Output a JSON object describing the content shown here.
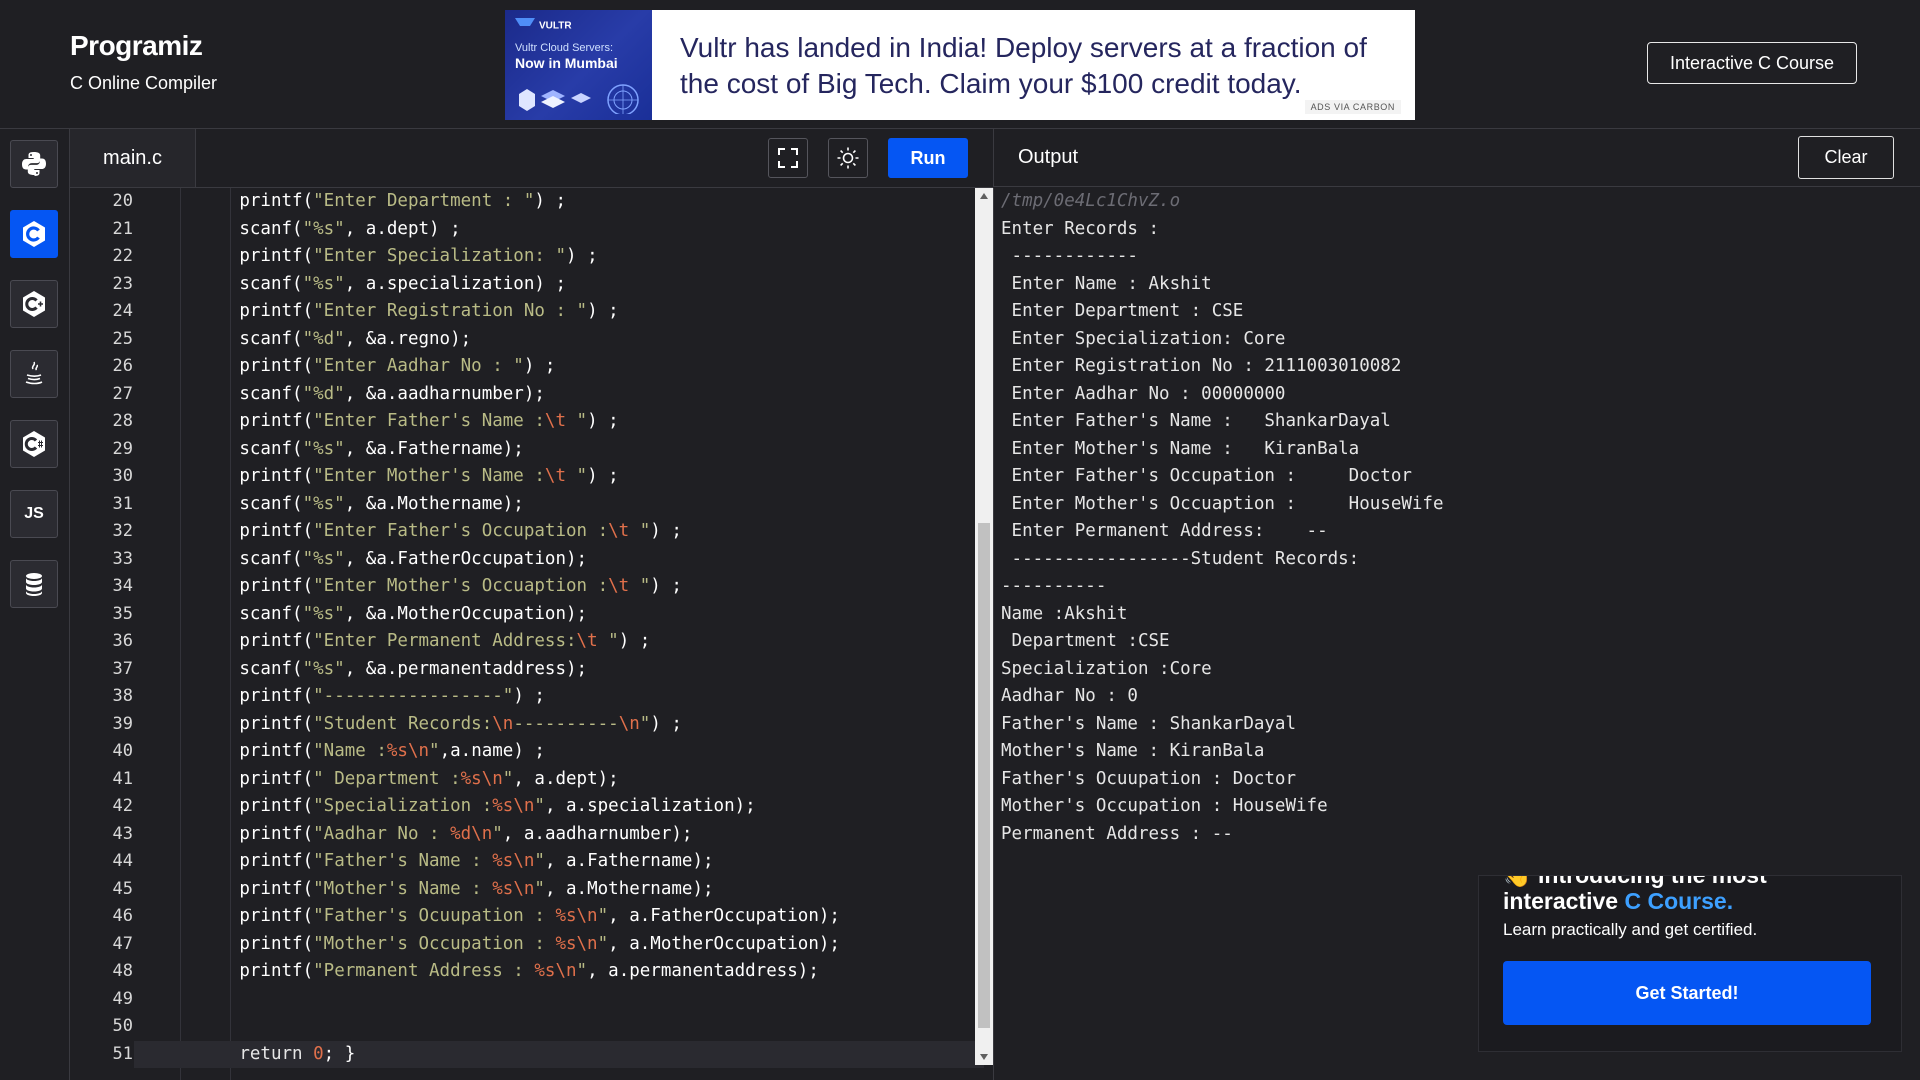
{
  "header": {
    "logo": "Programiz",
    "subtitle": "C Online Compiler",
    "course_button": "Interactive C Course"
  },
  "ad": {
    "brand": "VULTR",
    "image_line1": "Vultr Cloud Servers:",
    "image_line2": "Now in Mumbai",
    "text": "Vultr has landed in India! Deploy servers at a fraction of the cost of Big Tech. Claim your $100 credit today.",
    "carbon": "ADS VIA CARBON"
  },
  "sidebar": {
    "items": [
      {
        "name": "python",
        "icon": "python-icon",
        "active": false
      },
      {
        "name": "c",
        "icon": "c-icon",
        "active": true
      },
      {
        "name": "cpp",
        "icon": "cpp-icon",
        "active": false
      },
      {
        "name": "java",
        "icon": "java-icon",
        "active": false
      },
      {
        "name": "csharp",
        "icon": "csharp-icon",
        "active": false
      },
      {
        "name": "javascript",
        "icon": "js-icon",
        "label": "JS",
        "active": false
      },
      {
        "name": "sql",
        "icon": "database-icon",
        "active": false
      }
    ]
  },
  "editor": {
    "tab": "main.c",
    "run_label": "Run",
    "lines": [
      {
        "n": "20",
        "tokens": [
          [
            "fn",
            "printf("
          ],
          [
            "str",
            "\"Enter Department : \""
          ],
          [
            "fn",
            ") ;"
          ]
        ]
      },
      {
        "n": "21",
        "tokens": [
          [
            "fn",
            "scanf("
          ],
          [
            "str",
            "\"%s\""
          ],
          [
            "fn",
            ", a.dept) ;"
          ]
        ]
      },
      {
        "n": "22",
        "tokens": [
          [
            "fn",
            "printf("
          ],
          [
            "str",
            "\"Enter Specialization: \""
          ],
          [
            "fn",
            ") ;"
          ]
        ]
      },
      {
        "n": "23",
        "tokens": [
          [
            "fn",
            "scanf("
          ],
          [
            "str",
            "\"%s\""
          ],
          [
            "fn",
            ", a.specialization) ;"
          ]
        ]
      },
      {
        "n": "24",
        "tokens": [
          [
            "fn",
            "printf("
          ],
          [
            "str",
            "\"Enter Registration No : \""
          ],
          [
            "fn",
            ") ;"
          ]
        ]
      },
      {
        "n": "25",
        "tokens": [
          [
            "fn",
            "scanf("
          ],
          [
            "str",
            "\"%d\""
          ],
          [
            "fn",
            ", &a.regno);"
          ]
        ]
      },
      {
        "n": "26",
        "tokens": [
          [
            "fn",
            "printf("
          ],
          [
            "str",
            "\"Enter Aadhar No : \""
          ],
          [
            "fn",
            ") ;"
          ]
        ]
      },
      {
        "n": "27",
        "tokens": [
          [
            "fn",
            "scanf("
          ],
          [
            "str",
            "\"%d\""
          ],
          [
            "fn",
            ", &a.aadharnumber);"
          ]
        ]
      },
      {
        "n": "28",
        "tokens": [
          [
            "fn",
            "printf("
          ],
          [
            "str",
            "\"Enter Father's Name :"
          ],
          [
            "esc",
            "\\t"
          ],
          [
            "str",
            " \""
          ],
          [
            "fn",
            ") ;"
          ]
        ]
      },
      {
        "n": "29",
        "tokens": [
          [
            "fn",
            "scanf("
          ],
          [
            "str",
            "\"%s\""
          ],
          [
            "fn",
            ", &a.Fathername);"
          ]
        ]
      },
      {
        "n": "30",
        "tokens": [
          [
            "fn",
            "printf("
          ],
          [
            "str",
            "\"Enter Mother's Name :"
          ],
          [
            "esc",
            "\\t"
          ],
          [
            "str",
            " \""
          ],
          [
            "fn",
            ") ;"
          ]
        ]
      },
      {
        "n": "31",
        "tokens": [
          [
            "fn",
            "scanf("
          ],
          [
            "str",
            "\"%s\""
          ],
          [
            "fn",
            ", &a.Mothername);"
          ]
        ]
      },
      {
        "n": "32",
        "tokens": [
          [
            "fn",
            "printf("
          ],
          [
            "str",
            "\"Enter Father's Occupation :"
          ],
          [
            "esc",
            "\\t"
          ],
          [
            "str",
            " \""
          ],
          [
            "fn",
            ") ;"
          ]
        ]
      },
      {
        "n": "33",
        "tokens": [
          [
            "fn",
            "scanf("
          ],
          [
            "str",
            "\"%s\""
          ],
          [
            "fn",
            ", &a.FatherOccupation);"
          ]
        ]
      },
      {
        "n": "34",
        "tokens": [
          [
            "fn",
            "printf("
          ],
          [
            "str",
            "\"Enter Mother's Occuaption :"
          ],
          [
            "esc",
            "\\t"
          ],
          [
            "str",
            " \""
          ],
          [
            "fn",
            ") ;"
          ]
        ]
      },
      {
        "n": "35",
        "tokens": [
          [
            "fn",
            "scanf("
          ],
          [
            "str",
            "\"%s\""
          ],
          [
            "fn",
            ", &a.MotherOccupation);"
          ]
        ]
      },
      {
        "n": "36",
        "tokens": [
          [
            "fn",
            "printf("
          ],
          [
            "str",
            "\"Enter Permanent Address:"
          ],
          [
            "esc",
            "\\t"
          ],
          [
            "str",
            " \""
          ],
          [
            "fn",
            ") ;"
          ]
        ]
      },
      {
        "n": "37",
        "tokens": [
          [
            "fn",
            "scanf("
          ],
          [
            "str",
            "\"%s\""
          ],
          [
            "fn",
            ", &a.permanentaddress);"
          ]
        ]
      },
      {
        "n": "38",
        "tokens": [
          [
            "fn",
            "printf("
          ],
          [
            "str",
            "\"-----------------\""
          ],
          [
            "fn",
            ") ;"
          ]
        ]
      },
      {
        "n": "39",
        "tokens": [
          [
            "fn",
            "printf("
          ],
          [
            "str",
            "\"Student Records:"
          ],
          [
            "esc",
            "\\n"
          ],
          [
            "str",
            "----------"
          ],
          [
            "esc",
            "\\n"
          ],
          [
            "str",
            "\""
          ],
          [
            "fn",
            ") ;"
          ]
        ]
      },
      {
        "n": "40",
        "tokens": [
          [
            "fn",
            "printf("
          ],
          [
            "str",
            "\"Name :"
          ],
          [
            "esc",
            "%s\\n"
          ],
          [
            "str",
            "\""
          ],
          [
            "fn",
            ",a.name) ;"
          ]
        ]
      },
      {
        "n": "41",
        "tokens": [
          [
            "fn",
            "printf("
          ],
          [
            "str",
            "\" Department :"
          ],
          [
            "esc",
            "%s\\n"
          ],
          [
            "str",
            "\""
          ],
          [
            "fn",
            ", a.dept);"
          ]
        ]
      },
      {
        "n": "42",
        "tokens": [
          [
            "fn",
            "printf("
          ],
          [
            "str",
            "\"Specialization :"
          ],
          [
            "esc",
            "%s\\n"
          ],
          [
            "str",
            "\""
          ],
          [
            "fn",
            ", a.specialization);"
          ]
        ]
      },
      {
        "n": "43",
        "tokens": [
          [
            "fn",
            "printf("
          ],
          [
            "str",
            "\"Aadhar No : "
          ],
          [
            "esc",
            "%d\\n"
          ],
          [
            "str",
            "\""
          ],
          [
            "fn",
            ", a.aadharnumber);"
          ]
        ]
      },
      {
        "n": "44",
        "tokens": [
          [
            "fn",
            "printf("
          ],
          [
            "str",
            "\"Father's Name : "
          ],
          [
            "esc",
            "%s\\n"
          ],
          [
            "str",
            "\""
          ],
          [
            "fn",
            ", a.Fathername);"
          ]
        ]
      },
      {
        "n": "45",
        "tokens": [
          [
            "fn",
            "printf("
          ],
          [
            "str",
            "\"Mother's Name : "
          ],
          [
            "esc",
            "%s\\n"
          ],
          [
            "str",
            "\""
          ],
          [
            "fn",
            ", a.Mothername);"
          ]
        ]
      },
      {
        "n": "46",
        "tokens": [
          [
            "fn",
            "printf("
          ],
          [
            "str",
            "\"Father's Ocuupation : "
          ],
          [
            "esc",
            "%s\\n"
          ],
          [
            "str",
            "\""
          ],
          [
            "fn",
            ", a.FatherOccupation);"
          ]
        ]
      },
      {
        "n": "47",
        "tokens": [
          [
            "fn",
            "printf("
          ],
          [
            "str",
            "\"Mother's Occupation : "
          ],
          [
            "esc",
            "%s\\n"
          ],
          [
            "str",
            "\""
          ],
          [
            "fn",
            ", a.MotherOccupation);"
          ]
        ]
      },
      {
        "n": "48",
        "tokens": [
          [
            "fn",
            "printf("
          ],
          [
            "str",
            "\"Permanent Address : "
          ],
          [
            "esc",
            "%s\\n"
          ],
          [
            "str",
            "\""
          ],
          [
            "fn",
            ", a.permanentaddress);"
          ]
        ]
      },
      {
        "n": "49",
        "tokens": []
      },
      {
        "n": "50",
        "tokens": []
      },
      {
        "n": "51",
        "tokens": [
          [
            "kw",
            "return "
          ],
          [
            "num",
            "0"
          ],
          [
            "fn",
            "; }"
          ]
        ],
        "current": true
      }
    ]
  },
  "output": {
    "title": "Output",
    "clear_label": "Clear",
    "lines": [
      {
        "text": "/tmp/0e4Lc1ChvZ.o",
        "path": true
      },
      {
        "text": "Enter Records :"
      },
      {
        "text": " ------------"
      },
      {
        "text": " Enter Name : Akshit"
      },
      {
        "text": " Enter Department : CSE"
      },
      {
        "text": " Enter Specialization: Core"
      },
      {
        "text": " Enter Registration No : 2111003010082"
      },
      {
        "text": " Enter Aadhar No : 00000000"
      },
      {
        "text": " Enter Father's Name :   ShankarDayal"
      },
      {
        "text": " Enter Mother's Name :   KiranBala"
      },
      {
        "text": " Enter Father's Occupation :     Doctor"
      },
      {
        "text": " Enter Mother's Occuaption :     HouseWife"
      },
      {
        "text": " Enter Permanent Address:    --"
      },
      {
        "text": " -----------------Student Records:"
      },
      {
        "text": "----------"
      },
      {
        "text": "Name :Akshit"
      },
      {
        "text": " Department :CSE"
      },
      {
        "text": "Specialization :Core"
      },
      {
        "text": "Aadhar No : 0"
      },
      {
        "text": "Father's Name : ShankarDayal"
      },
      {
        "text": "Mother's Name : KiranBala"
      },
      {
        "text": "Father's Ocuupation : Doctor"
      },
      {
        "text": "Mother's Occupation : HouseWife"
      },
      {
        "text": "Permanent Address : --"
      }
    ]
  },
  "promo": {
    "line1": "👋 Introducing the most",
    "line2_prefix": "interactive ",
    "line2_highlight": "C Course.",
    "subtitle": "Learn practically and get certified.",
    "button": "Get Started!"
  },
  "colors": {
    "accent": "#0556f3",
    "background": "#1f1f23",
    "string": "#b9bb86",
    "escape": "#e0704b"
  }
}
